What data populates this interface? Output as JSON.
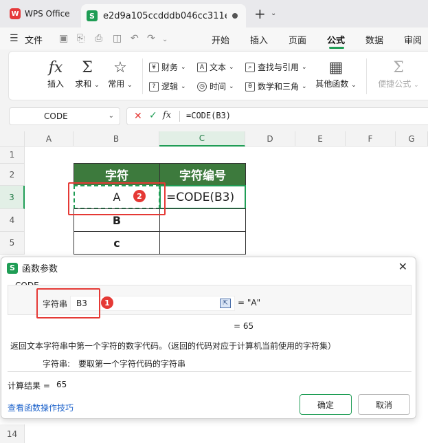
{
  "titlebar": {
    "app_name": "WPS Office",
    "doc_tab_title": "e2d9a105ccdddb046cc311e",
    "new_tab": "+",
    "tab_dropdown": "⌄"
  },
  "menubar": {
    "file_label": "文件",
    "tabs": [
      "开始",
      "插入",
      "页面",
      "公式",
      "数据",
      "审阅"
    ],
    "active_tab": "公式"
  },
  "ribbon": {
    "insert_label": "插入",
    "sum_label": "求和",
    "common_label": "常用",
    "finance_label": "财务",
    "text_label": "文本",
    "lookup_label": "查找与引用",
    "logic_label": "逻辑",
    "time_label": "时间",
    "math_label": "数学和三角",
    "other_label": "其他函数",
    "quick_label": "便捷公式"
  },
  "formula_bar": {
    "name_box": "CODE",
    "formula": "=CODE(B3)"
  },
  "grid": {
    "columns": [
      "A",
      "B",
      "C",
      "D",
      "E",
      "F",
      "G"
    ],
    "rows": [
      "1",
      "2",
      "3",
      "4",
      "5"
    ],
    "header_b": "字符",
    "header_c": "字符编号",
    "b3": "A",
    "c3": "=CODE(B3)",
    "b4": "B",
    "b5": "c",
    "bottom_row": "14"
  },
  "dialog": {
    "title": "函数参数",
    "group_label": "CODE",
    "param_label": "字符串",
    "param_value": "B3",
    "param_result": "= \"A\"",
    "func_result": "= 65",
    "description": "返回文本字符串中第一个字符的数字代码。（返回的代码对应于计算机当前使用的字符集）",
    "param_desc_label": "字符串:",
    "param_desc": "要取第一个字符代码的字符串",
    "calc_result_label": "计算结果 =",
    "calc_result_value": "65",
    "help_link": "查看函数操作技巧",
    "ok_label": "确定",
    "cancel_label": "取消"
  },
  "badges": {
    "one": "1",
    "two": "2"
  },
  "colors": {
    "accent": "#1f9d55",
    "header_fill": "#3d7a3d",
    "highlight": "#e53935"
  }
}
